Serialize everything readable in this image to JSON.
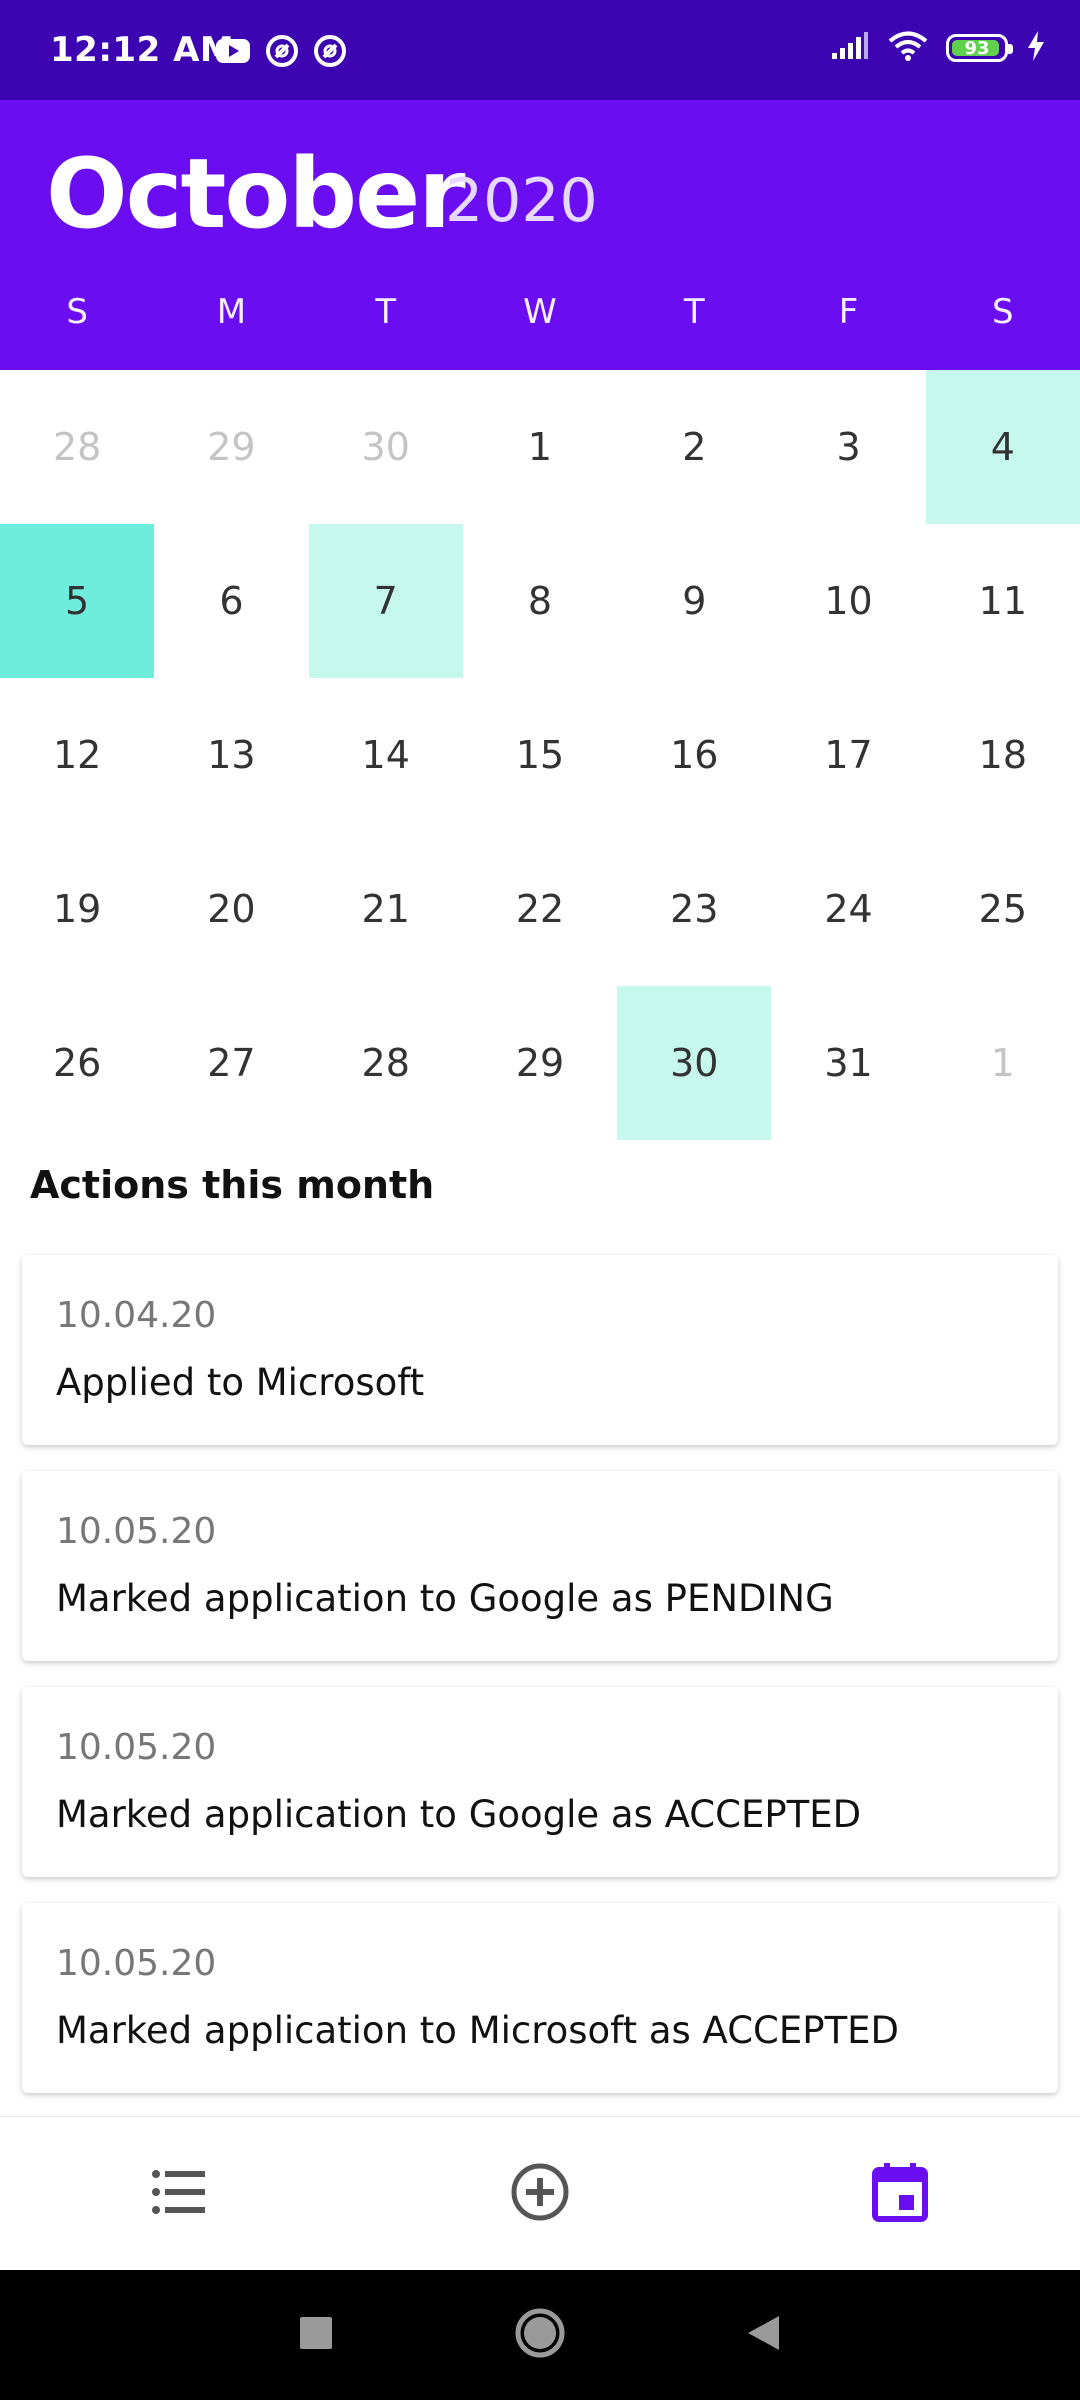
{
  "status_bar": {
    "time": "12:12 AM",
    "left_icons": [
      "youtube-icon",
      "notification-icon",
      "notification-icon"
    ],
    "right_icons": [
      "signal-icon",
      "wifi-icon",
      "battery-icon",
      "charging-icon"
    ],
    "battery_level": "93",
    "battery_fraction": 0.93
  },
  "header": {
    "month": "October",
    "year": "2020",
    "weekdays": [
      "S",
      "M",
      "T",
      "W",
      "T",
      "F",
      "S"
    ]
  },
  "calendar": {
    "days": [
      {
        "label": "28",
        "muted": true,
        "hl": ""
      },
      {
        "label": "29",
        "muted": true,
        "hl": ""
      },
      {
        "label": "30",
        "muted": true,
        "hl": ""
      },
      {
        "label": "1",
        "muted": false,
        "hl": ""
      },
      {
        "label": "2",
        "muted": false,
        "hl": ""
      },
      {
        "label": "3",
        "muted": false,
        "hl": ""
      },
      {
        "label": "4",
        "muted": false,
        "hl": "light"
      },
      {
        "label": "5",
        "muted": false,
        "hl": "strong"
      },
      {
        "label": "6",
        "muted": false,
        "hl": ""
      },
      {
        "label": "7",
        "muted": false,
        "hl": "light"
      },
      {
        "label": "8",
        "muted": false,
        "hl": ""
      },
      {
        "label": "9",
        "muted": false,
        "hl": ""
      },
      {
        "label": "10",
        "muted": false,
        "hl": ""
      },
      {
        "label": "11",
        "muted": false,
        "hl": ""
      },
      {
        "label": "12",
        "muted": false,
        "hl": ""
      },
      {
        "label": "13",
        "muted": false,
        "hl": ""
      },
      {
        "label": "14",
        "muted": false,
        "hl": ""
      },
      {
        "label": "15",
        "muted": false,
        "hl": ""
      },
      {
        "label": "16",
        "muted": false,
        "hl": ""
      },
      {
        "label": "17",
        "muted": false,
        "hl": ""
      },
      {
        "label": "18",
        "muted": false,
        "hl": ""
      },
      {
        "label": "19",
        "muted": false,
        "hl": ""
      },
      {
        "label": "20",
        "muted": false,
        "hl": ""
      },
      {
        "label": "21",
        "muted": false,
        "hl": ""
      },
      {
        "label": "22",
        "muted": false,
        "hl": ""
      },
      {
        "label": "23",
        "muted": false,
        "hl": ""
      },
      {
        "label": "24",
        "muted": false,
        "hl": ""
      },
      {
        "label": "25",
        "muted": false,
        "hl": ""
      },
      {
        "label": "26",
        "muted": false,
        "hl": ""
      },
      {
        "label": "27",
        "muted": false,
        "hl": ""
      },
      {
        "label": "28",
        "muted": false,
        "hl": ""
      },
      {
        "label": "29",
        "muted": false,
        "hl": ""
      },
      {
        "label": "30",
        "muted": false,
        "hl": "light"
      },
      {
        "label": "31",
        "muted": false,
        "hl": ""
      },
      {
        "label": "1",
        "muted": true,
        "hl": ""
      }
    ]
  },
  "actions": {
    "title": "Actions this month",
    "items": [
      {
        "date": "10.04.20",
        "text": "Applied to Microsoft"
      },
      {
        "date": "10.05.20",
        "text": "Marked application to Google as PENDING"
      },
      {
        "date": "10.05.20",
        "text": "Marked application to Google as ACCEPTED"
      },
      {
        "date": "10.05.20",
        "text": "Marked application to Microsoft as ACCEPTED"
      }
    ]
  },
  "bottom_nav": {
    "items": [
      {
        "icon": "list-icon",
        "active": false
      },
      {
        "icon": "add-circle-icon",
        "active": false
      },
      {
        "icon": "calendar-icon",
        "active": true
      }
    ]
  },
  "system_nav": {
    "items": [
      "recents-icon",
      "home-icon",
      "back-icon"
    ]
  },
  "colors": {
    "status_bar": "#3d05b2",
    "header": "#6a0df0",
    "highlight_light": "#c7f8ee",
    "highlight_strong": "#6eeddc",
    "nav_active": "#6a0df0",
    "nav_inactive": "#555555"
  }
}
